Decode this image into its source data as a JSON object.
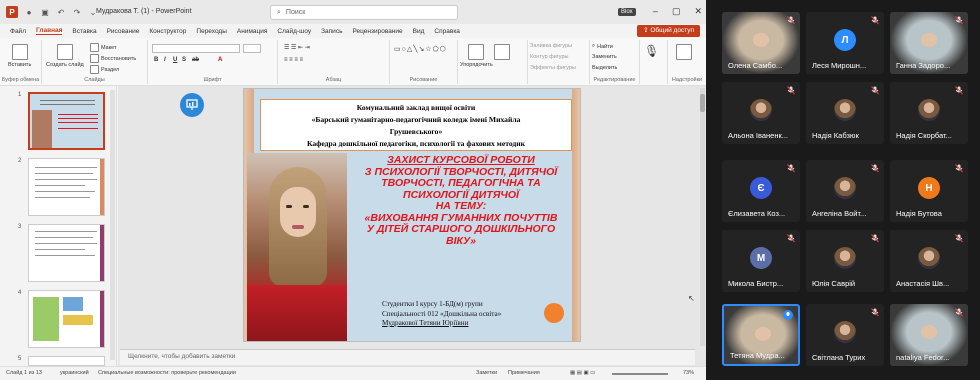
{
  "titlebar": {
    "title": "Мудракова Т. (1)  -  PowerPoint",
    "search_placeholder": "Поиск",
    "user_badge": "Blox"
  },
  "menu": {
    "items": [
      "Файл",
      "Главная",
      "Вставка",
      "Рисование",
      "Конструктор",
      "Переходы",
      "Анимация",
      "Слайд-шоу",
      "Запись",
      "Рецензирование",
      "Вид",
      "Справка"
    ],
    "active": "Главная",
    "share_label": "Общий доступ"
  },
  "ribbon": {
    "paste_label": "Вставить",
    "clipboard_label": "Буфер обмена",
    "new_slide_label": "Создать слайд",
    "slides_label": "Слайды",
    "layout_label": "Макет",
    "reset_label": "Восстановить",
    "section_label": "Раздел",
    "font_label": "Шрифт",
    "paragraph_label": "Абзац",
    "drawing_label": "Рисование",
    "arrange_label": "Упорядочить",
    "styles_label": "Экспресс-стили",
    "fill_label": "Заливка фигуры",
    "outline_label": "Контур фигуры",
    "effects_label": "Эффекты фигуры",
    "find_label": "Найти",
    "replace_label": "Заменить",
    "select_label": "Выделить",
    "editing_label": "Редактирование",
    "dictate_label": "Диктовать",
    "voice_label": "Голос",
    "designer_label": "Конструктор",
    "addins_label": "Надстройки"
  },
  "slides": {
    "numbers": [
      "1",
      "2",
      "3",
      "4",
      "5"
    ]
  },
  "notes_placeholder": "Щелкните, чтобы добавить заметки",
  "statusbar": {
    "slide_info": "Слайд 1 из 13",
    "language": "украинский",
    "accessibility": "Специальные возможности: проверьте рекомендации",
    "notes": "Заметки",
    "comments": "Примечания",
    "zoom": "73%"
  },
  "slide": {
    "header_lines": [
      "Комунальний заклад вищої освіти",
      "«Барський гуманітарно-педагогічний коледж імені Михайла",
      "Грушевського»",
      "Кафедра дошкільної педагогіки, психології та фахових методик"
    ],
    "red_lines": [
      "ЗАХИСТ КУРСОВОЇ  РОБОТИ",
      "З ПСИХОЛОГІЇ ТВОРЧОСТІ, ДИТЯЧОЇ",
      "ТВОРЧОСТІ, ПЕДАГОГІЧНА ТА",
      "ПСИХОЛОГІЇ ДИТЯЧОЇ",
      "НА ТЕМУ:",
      "«ВИХОВАННЯ ГУМАННИХ ПОЧУТТІВ",
      "У ДІТЕЙ СТАРШОГО ДОШКІЛЬНОГО",
      "ВІКУ»"
    ],
    "author_lines": [
      "Студентки  І  курсу 1-БД(м) групи",
      "Спеціальності 012 «Дошкільна освіта»",
      "Мудракової Тетяни Юріївни"
    ]
  },
  "participants": [
    {
      "name": "Олена Самбо...",
      "type": "video",
      "muted": true
    },
    {
      "name": "Леся Мирошн...",
      "type": "initial",
      "initial": "Л",
      "color": "#2d8cff",
      "muted": true
    },
    {
      "name": "Ганна Задоро...",
      "type": "video",
      "muted": true
    },
    {
      "name": "Альона Іваненк...",
      "type": "photo",
      "muted": true
    },
    {
      "name": "Надія Кабзюк",
      "type": "photo",
      "muted": true
    },
    {
      "name": "Надія Скорбат...",
      "type": "photo",
      "muted": true
    },
    {
      "name": "Єлизавета Коз...",
      "type": "initial",
      "initial": "Є",
      "color": "#3a5bd9",
      "muted": true
    },
    {
      "name": "Ангеліна Войт...",
      "type": "photo",
      "muted": true
    },
    {
      "name": "Надія Бутова",
      "type": "initial",
      "initial": "Н",
      "color": "#f07a1a",
      "muted": true
    },
    {
      "name": "Микола Бистр...",
      "type": "initial",
      "initial": "М",
      "color": "#5b6ea8",
      "muted": true
    },
    {
      "name": "Юлія Саврій",
      "type": "photo",
      "muted": true
    },
    {
      "name": "Анастасія Шв...",
      "type": "photo",
      "muted": true
    },
    {
      "name": "Тетяна Мудра...",
      "type": "video",
      "muted": false,
      "active": true
    },
    {
      "name": "Світлана Турих",
      "type": "photo",
      "muted": true
    },
    {
      "name": "nataliya Fedor...",
      "type": "video",
      "muted": true
    }
  ]
}
